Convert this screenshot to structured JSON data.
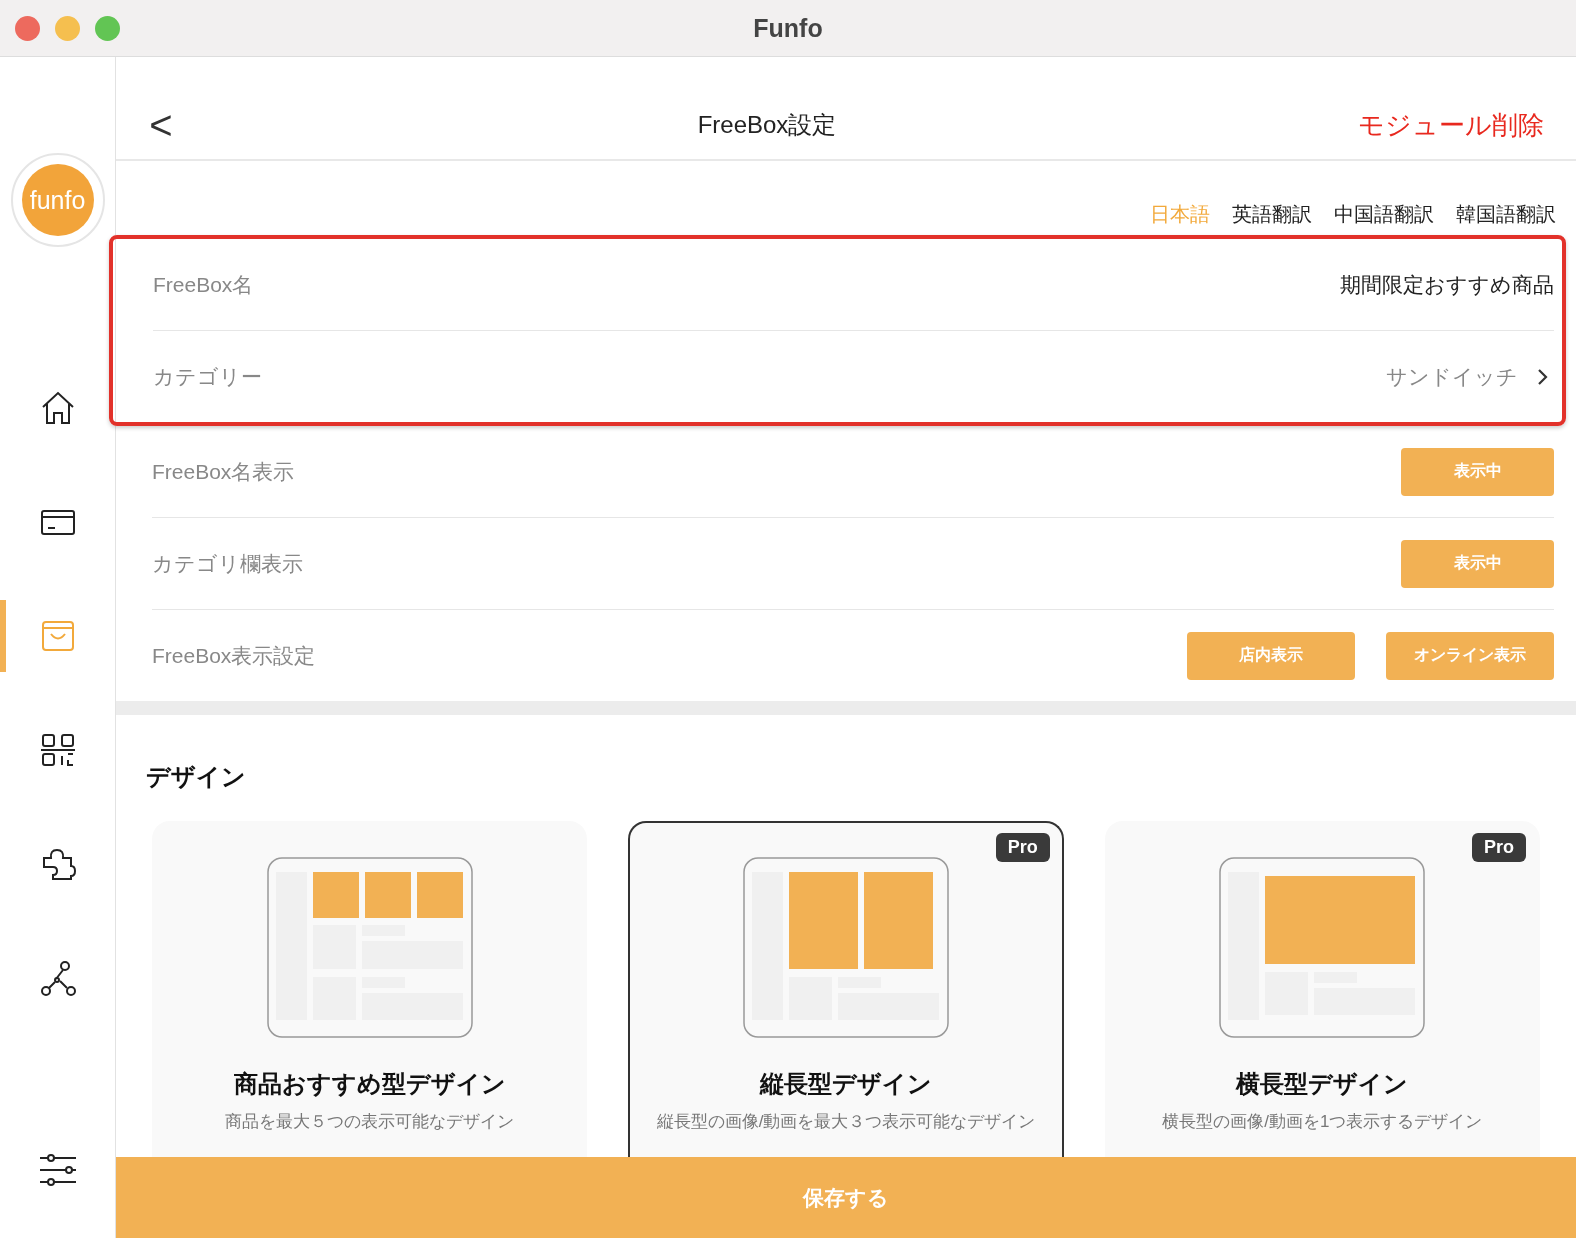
{
  "window": {
    "title": "Funfo"
  },
  "sidebar": {
    "logo": "funfo",
    "items": [
      {
        "kind": "home",
        "selected": false
      },
      {
        "kind": "card",
        "selected": false
      },
      {
        "kind": "bag",
        "selected": true
      },
      {
        "kind": "qr",
        "selected": false
      },
      {
        "kind": "puzzle",
        "selected": false
      },
      {
        "kind": "nodes",
        "selected": false
      }
    ],
    "bottom_item": {
      "kind": "sliders"
    }
  },
  "header": {
    "back": "<",
    "title": "FreeBox設定",
    "delete": "モジュール削除"
  },
  "language_tabs": [
    {
      "label": "日本語",
      "selected": true
    },
    {
      "label": "英語翻訳",
      "selected": false
    },
    {
      "label": "中国語翻訳",
      "selected": false
    },
    {
      "label": "韓国語翻訳",
      "selected": false
    }
  ],
  "highlighted_rows": [
    {
      "kind": "text",
      "label": "FreeBox名",
      "value": "期間限定おすすめ商品"
    },
    {
      "kind": "link",
      "label": "カテゴリー",
      "value": "サンドイッチ"
    }
  ],
  "rows": [
    {
      "kind": "buttons",
      "label": "FreeBox名表示",
      "buttons": [
        "表示中"
      ]
    },
    {
      "kind": "buttons",
      "label": "カテゴリ欄表示",
      "buttons": [
        "表示中"
      ]
    },
    {
      "kind": "buttons",
      "label": "FreeBox表示設定",
      "buttons": [
        "店内表示",
        "オンライン表示"
      ]
    }
  ],
  "design": {
    "heading": "デザイン",
    "cards": [
      {
        "kind": "grid",
        "selected": false,
        "title": "商品おすすめ型デザイン",
        "lines": [
          "商品を最大５つの表示可能なデザイン"
        ]
      },
      {
        "kind": "tall",
        "selected": true,
        "badge": "Pro",
        "title": "縦長型デザイン",
        "lines": [
          "縦長型の画像/動画を最大３つ表示可能なデザイン"
        ]
      },
      {
        "kind": "wide",
        "selected": false,
        "badge": "Pro",
        "title": "横長型デザイン",
        "lines": [
          "横長型の画像/動画を1つ表示するデザイン"
        ]
      }
    ]
  },
  "save_button": "保存する"
}
